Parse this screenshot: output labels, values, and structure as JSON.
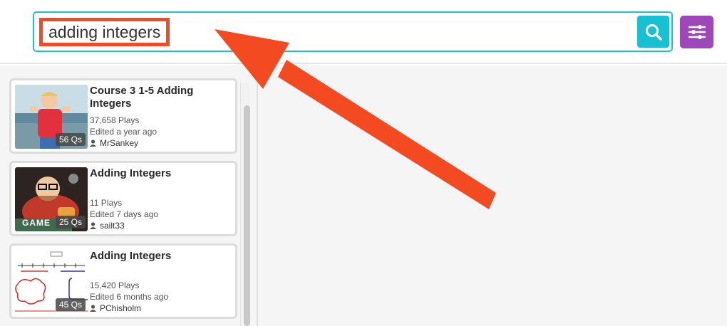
{
  "search": {
    "value": "adding integers"
  },
  "results": [
    {
      "title": "Course 3 1-5 Adding Integers",
      "questions": "56 Qs",
      "plays": "37,658 Plays",
      "edited": "Edited a year ago",
      "author": "MrSankey"
    },
    {
      "title": "Adding Integers",
      "questions": "25 Qs",
      "plays": "11 Plays",
      "edited": "Edited 7 days ago",
      "author": "sailt33"
    },
    {
      "title": "Adding Integers",
      "questions": "45 Qs",
      "plays": "15,420 Plays",
      "edited": "Edited 6 months ago",
      "author": "PChisholm"
    }
  ],
  "thumb_text": {
    "game": "GAME"
  },
  "colors": {
    "search_border": "#1fbfcf",
    "search_button": "#18c1d1",
    "filter_button": "#9e47b8",
    "highlight": "#f04b24"
  },
  "icons": {
    "search": "search-icon",
    "filter": "sliders-icon",
    "author": "user-icon"
  }
}
